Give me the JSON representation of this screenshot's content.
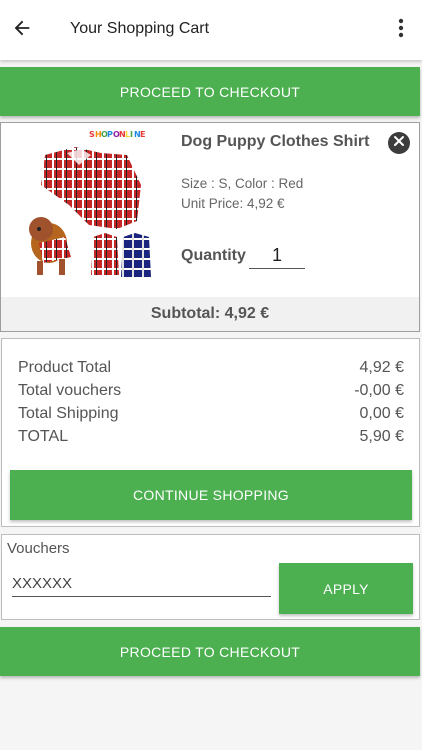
{
  "header": {
    "title": "Your Shopping Cart",
    "back_icon": "arrow-left-icon",
    "menu_icon": "more-vertical-icon"
  },
  "checkout": {
    "top_label": "PROCEED TO CHECKOUT",
    "bottom_label": "PROCEED TO CHECKOUT"
  },
  "product": {
    "name": "Dog Puppy Clothes Shirt",
    "size_color": "Size : S, Color : Red",
    "unit_price": "Unit Price: 4,92 €",
    "quantity_label": "Quantity",
    "quantity_value": "1",
    "subtotal": "Subtotal: 4,92 €",
    "image_brand_text": "SHOPONLINE"
  },
  "totals": {
    "rows": [
      {
        "label": "Product Total",
        "value": "4,92 €"
      },
      {
        "label": "Total vouchers",
        "value": "-0,00 €"
      },
      {
        "label": "Total Shipping",
        "value": "0,00 €"
      },
      {
        "label": "TOTAL",
        "value": "5,90 €"
      }
    ],
    "continue_label": "CONTINUE SHOPPING"
  },
  "vouchers": {
    "label": "Vouchers",
    "input_value": "XXXXXX",
    "apply_label": "APPLY"
  },
  "colors": {
    "accent": "#4caf50",
    "remove": "#3c3c3c"
  }
}
